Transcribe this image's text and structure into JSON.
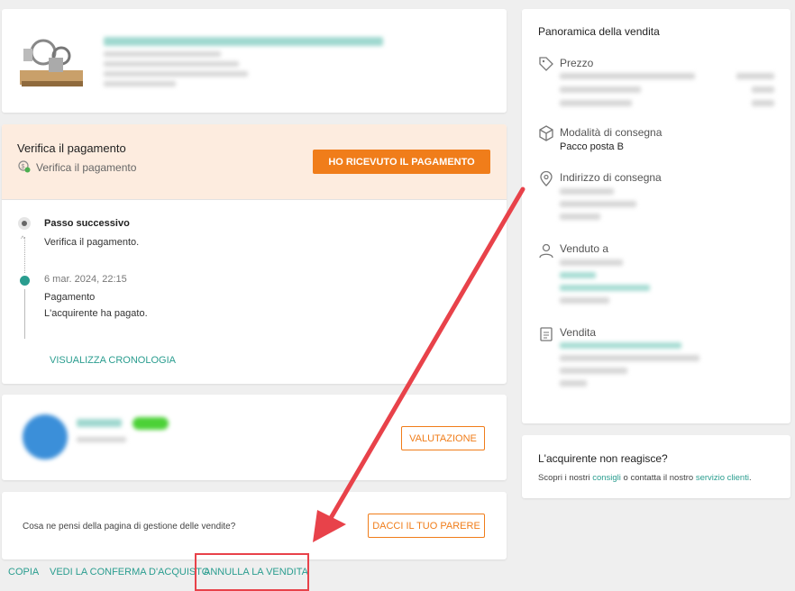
{
  "product": {
    "title_blurred": "Stirling motor",
    "detail_lines": [
      "",
      "",
      "",
      ""
    ]
  },
  "payment": {
    "heading": "Verifica il pagamento",
    "sub": "Verifica il pagamento",
    "button": "HO RICEVUTO IL PAGAMENTO"
  },
  "timeline": {
    "next_label": "Passo successivo",
    "next_text": "Verifica il pagamento.",
    "date": "6 mar. 2024, 22:15",
    "event_label": "Pagamento",
    "event_text": "L'acquirente ha pagato.",
    "history_link": "VISUALIZZA CRONOLOGIA"
  },
  "buyer": {
    "rating_button": "VALUTAZIONE"
  },
  "feedback": {
    "question": "Cosa ne pensi della pagina di gestione delle vendite?",
    "button": "DACCI IL TUO PARERE"
  },
  "footer_links": {
    "copy": "COPIA",
    "confirm": "VEDI LA CONFERMA D'ACQUISTO",
    "cancel": "ANNULLA LA VENDITA"
  },
  "overview": {
    "title": "Panoramica della vendita",
    "price_label": "Prezzo",
    "delivery_label": "Modalità di consegna",
    "delivery_value": "Pacco posta B",
    "address_label": "Indirizzo di consegna",
    "sold_to_label": "Venduto a",
    "sale_label": "Vendita"
  },
  "help": {
    "title": "L'acquirente non reagisce?",
    "text_prefix": "Scopri i nostri",
    "link_tips": "consigli",
    "text_middle": "o contatta il nostro",
    "link_service": "servizio clienti",
    "text_suffix": "."
  },
  "colors": {
    "accent_orange": "#f07d1a",
    "teal": "#2a9d8f",
    "annotation_red": "#e8424a"
  }
}
